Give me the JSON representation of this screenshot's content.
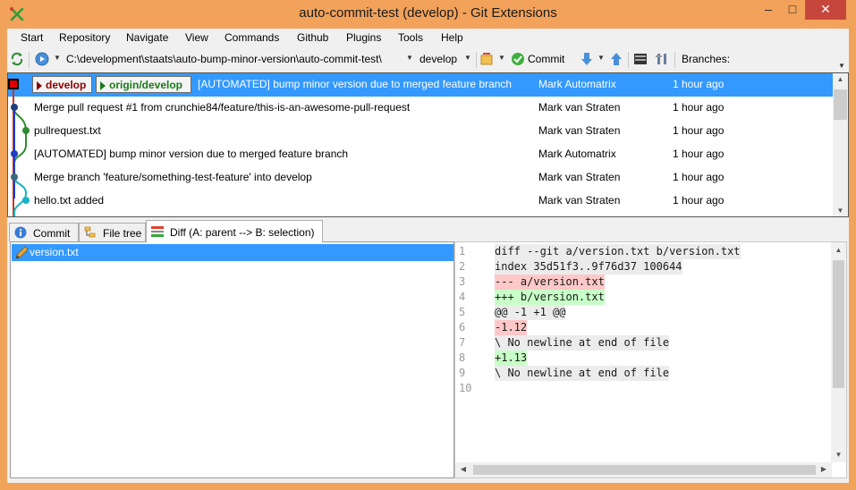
{
  "window": {
    "title": "auto-commit-test (develop) - Git Extensions",
    "minimize": "–",
    "maximize": "□",
    "close": "✕"
  },
  "menu": [
    "Start",
    "Repository",
    "Navigate",
    "View",
    "Commands",
    "Github",
    "Plugins",
    "Tools",
    "Help"
  ],
  "toolbar": {
    "path": "C:\\development\\staats\\auto-bump-minor-version\\auto-commit-test\\",
    "branch": "develop",
    "commit_label": "Commit",
    "branches_label": "Branches:"
  },
  "revisions": [
    {
      "message": "[AUTOMATED] bump minor version due to merged feature branch",
      "author": "Mark Automatrix",
      "date": "1 hour ago",
      "selected": true
    },
    {
      "message": "Merge pull request #1 from crunchie84/feature/this-is-an-awesome-pull-request",
      "author": "Mark van Straten",
      "date": "1 hour ago"
    },
    {
      "message": "pullrequest.txt",
      "author": "Mark van Straten",
      "date": "1 hour ago"
    },
    {
      "message": "[AUTOMATED] bump minor version due to merged feature branch",
      "author": "Mark Automatrix",
      "date": "1 hour ago"
    },
    {
      "message": "Merge branch 'feature/something-test-feature' into develop",
      "author": "Mark van Straten",
      "date": "1 hour ago"
    },
    {
      "message": "hello.txt added",
      "author": "Mark van Straten",
      "date": "1 hour ago"
    }
  ],
  "branch_labels": {
    "local": "develop",
    "remote": "origin/develop"
  },
  "tabs": [
    "Commit",
    "File tree",
    "Diff (A: parent --> B: selection)"
  ],
  "files": [
    {
      "name": "version.txt"
    }
  ],
  "diff": {
    "line_numbers": [
      "1",
      "2",
      "3",
      "4",
      "5",
      "6",
      "7",
      "8",
      "9",
      "10"
    ],
    "lines": [
      {
        "text": "diff --git a/version.txt b/version.txt",
        "type": "meta"
      },
      {
        "text": "index 35d51f3..9f76d37 100644",
        "type": "meta"
      },
      {
        "text": "--- a/version.txt",
        "type": "rem"
      },
      {
        "text": "+++ b/version.txt",
        "type": "add"
      },
      {
        "text": "@@ -1 +1 @@",
        "type": "meta"
      },
      {
        "text": "-1.12",
        "type": "rem"
      },
      {
        "text": "\\ No newline at end of file",
        "type": "meta"
      },
      {
        "text": "+1.13",
        "type": "add"
      },
      {
        "text": "\\ No newline at end of file",
        "type": "meta"
      }
    ]
  },
  "colors": {
    "accent": "#3399ff",
    "titlebar": "#f2a25b",
    "close": "#c7463c",
    "removed": "#ffc8c8",
    "added": "#c8ffc8"
  }
}
